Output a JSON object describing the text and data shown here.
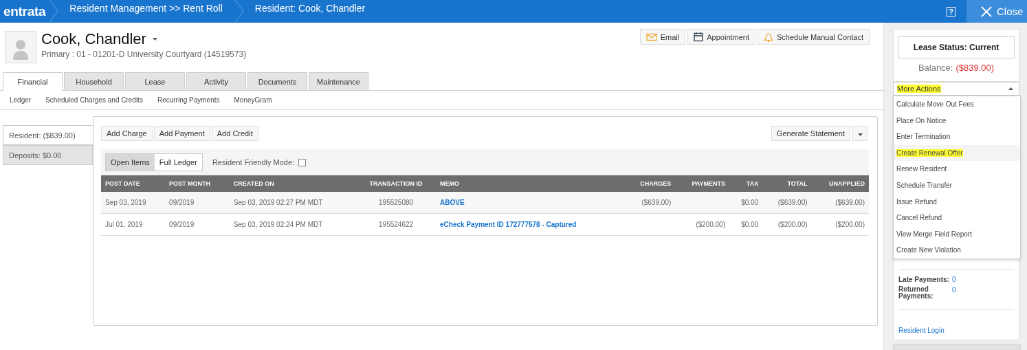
{
  "header": {
    "logo": "entrata",
    "breadcrumbs": [
      "Resident Management >> Rent Roll",
      "Resident: Cook, Chandler"
    ],
    "help": "?",
    "close": "Close"
  },
  "resident": {
    "name": "Cook, Chandler",
    "subtitle": "Primary : 01 - 01201-D University Courtyard (14519573)"
  },
  "contact_buttons": [
    {
      "kind": "email",
      "label": "Email"
    },
    {
      "kind": "calendar",
      "label": "Appointment"
    },
    {
      "kind": "bell",
      "label": "Schedule Manual Contact"
    }
  ],
  "tabs": [
    {
      "label": "Financial",
      "selected": true
    },
    {
      "label": "Household",
      "selected": false
    },
    {
      "label": "Lease",
      "selected": false
    },
    {
      "label": "Activity",
      "selected": false
    },
    {
      "label": "Documents",
      "selected": false
    },
    {
      "label": "Maintenance",
      "selected": false
    }
  ],
  "subnav": [
    "Ledger",
    "Scheduled Charges and Credits",
    "Recurring Payments",
    "MoneyGram"
  ],
  "ledger_tabs": [
    {
      "label": "Resident: ($839.00)",
      "selected": true
    },
    {
      "label": "Deposits: $0.00",
      "selected": false
    }
  ],
  "actions": [
    "Add Charge",
    "Add Payment",
    "Add Credit"
  ],
  "statement_button": "Generate Statement",
  "view_toggle": [
    {
      "label": "Open Items",
      "selected": true
    },
    {
      "label": "Full Ledger",
      "selected": false
    }
  ],
  "friendly_mode": {
    "label": "Resident Friendly Mode:",
    "checked": false
  },
  "table": {
    "columns": [
      "POST DATE",
      "POST MONTH",
      "CREATED ON",
      "TRANSACTION ID",
      "MEMO",
      "CHARGES",
      "PAYMENTS",
      "TAX",
      "TOTAL",
      "UNAPPLIED"
    ],
    "rows": [
      [
        "Sep 03, 2019",
        "09/2019",
        "Sep 03, 2019 02:27 PM MDT",
        "195525080",
        "ABOVE",
        "($639.00)",
        "",
        "$0.00",
        "($639.00)",
        "($639.00)"
      ],
      [
        "Jul 01, 2019",
        "09/2019",
        "Sep 03, 2019 02:24 PM MDT",
        "195524622",
        "eCheck Payment ID 172777578 - Captured",
        "",
        "($200.00)",
        "$0.00",
        "($200.00)",
        "($200.00)"
      ]
    ]
  },
  "sidebar": {
    "lease_status": "Lease Status: Current",
    "balance_label": "Balance:",
    "balance_value": "($839.00)",
    "more_actions": {
      "label": "More Actions",
      "highlighted": true,
      "expanded": true,
      "items": [
        {
          "label": "Calculate Move Out Fees",
          "highlighted": false
        },
        {
          "label": "Place On Notice",
          "highlighted": false
        },
        {
          "label": "Enter Termination",
          "highlighted": false
        },
        {
          "label": "Create Renewal Offer",
          "highlighted": true
        },
        {
          "label": "Renew Resident",
          "highlighted": false
        },
        {
          "label": "Schedule Transfer",
          "highlighted": false
        },
        {
          "label": "Issue Refund",
          "highlighted": false
        },
        {
          "label": "Cancel Refund",
          "highlighted": false
        },
        {
          "label": "View Merge Field Report",
          "highlighted": false
        },
        {
          "label": "Create New Violation",
          "highlighted": false
        }
      ]
    },
    "stats": [
      {
        "label": "Late Payments:",
        "value": "0"
      },
      {
        "label": "Returned Payments:",
        "value": "0"
      }
    ],
    "login_link": "Resident Login"
  }
}
